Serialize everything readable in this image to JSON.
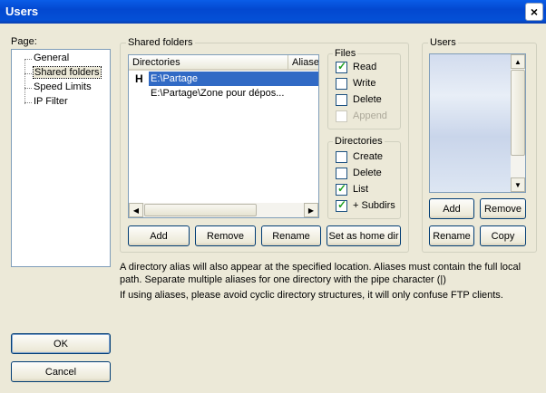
{
  "window": {
    "title": "Users",
    "close_glyph": "×"
  },
  "page": {
    "label": "Page:",
    "items": [
      "General",
      "Shared folders",
      "Speed Limits",
      "IP Filter"
    ],
    "selected": "Shared folders"
  },
  "shared_folders": {
    "legend": "Shared folders",
    "columns": [
      "Directories",
      "Aliases"
    ],
    "rows": [
      {
        "home_marker": "H",
        "path": "E:\\Partage"
      },
      {
        "home_marker": "",
        "path": "E:\\Partage\\Zone pour dépos..."
      }
    ],
    "buttons": {
      "add": "Add",
      "remove": "Remove",
      "rename": "Rename",
      "set_home": "Set as home dir"
    }
  },
  "files": {
    "legend": "Files",
    "items": [
      {
        "label": "Read",
        "checked": true,
        "enabled": true
      },
      {
        "label": "Write",
        "checked": false,
        "enabled": true
      },
      {
        "label": "Delete",
        "checked": false,
        "enabled": true
      },
      {
        "label": "Append",
        "checked": false,
        "enabled": false
      }
    ]
  },
  "directories": {
    "legend": "Directories",
    "items": [
      {
        "label": "Create",
        "checked": false
      },
      {
        "label": "Delete",
        "checked": false
      },
      {
        "label": "List",
        "checked": true
      },
      {
        "label": "+ Subdirs",
        "checked": true
      }
    ]
  },
  "users": {
    "legend": "Users",
    "buttons": {
      "add": "Add",
      "remove": "Remove",
      "rename": "Rename",
      "copy": "Copy"
    }
  },
  "info": {
    "line1": "A directory alias will also appear at the specified location. Aliases must contain the full local path. Separate multiple aliases for one directory with the pipe character (|)",
    "line2": "If using aliases, please avoid cyclic directory structures, it will only confuse FTP clients."
  },
  "dialog_buttons": {
    "ok": "OK",
    "cancel": "Cancel"
  },
  "colors": {
    "titlebar": "#0348d0",
    "selection": "#316ac5",
    "check": "#21a121"
  }
}
